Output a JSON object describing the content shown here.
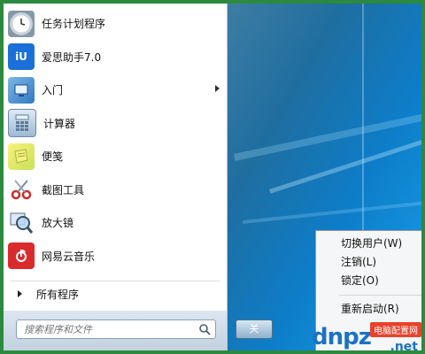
{
  "start_menu": {
    "items": [
      {
        "label": "任务计划程序",
        "icon": "clock-icon",
        "has_submenu": false
      },
      {
        "label": "爱思助手7.0",
        "icon": "aisi-icon",
        "icon_text": "iU",
        "has_submenu": false
      },
      {
        "label": "入门",
        "icon": "intro-icon",
        "has_submenu": true
      },
      {
        "label": "计算器",
        "icon": "calculator-icon",
        "has_submenu": false
      },
      {
        "label": "便笺",
        "icon": "sticky-notes-icon",
        "has_submenu": false
      },
      {
        "label": "截图工具",
        "icon": "scissors-icon",
        "has_submenu": false
      },
      {
        "label": "放大镜",
        "icon": "magnifier-icon",
        "has_submenu": false
      },
      {
        "label": "网易云音乐",
        "icon": "netease-music-icon",
        "has_submenu": false
      }
    ],
    "all_programs": "所有程序",
    "search_placeholder": "搜索程序和文件",
    "shutdown_label": "关"
  },
  "context_menu": {
    "items": [
      "切换用户(W)",
      "注销(L)",
      "锁定(O)",
      "重新启动(R)"
    ]
  },
  "watermark": {
    "text": "dnpz",
    "badge": "电脑配置网",
    "suffix": ".net"
  },
  "colors": {
    "border_green": "#2b8a3e",
    "menu_bg": "#ffffff",
    "accent_blue": "#1a72c4"
  }
}
